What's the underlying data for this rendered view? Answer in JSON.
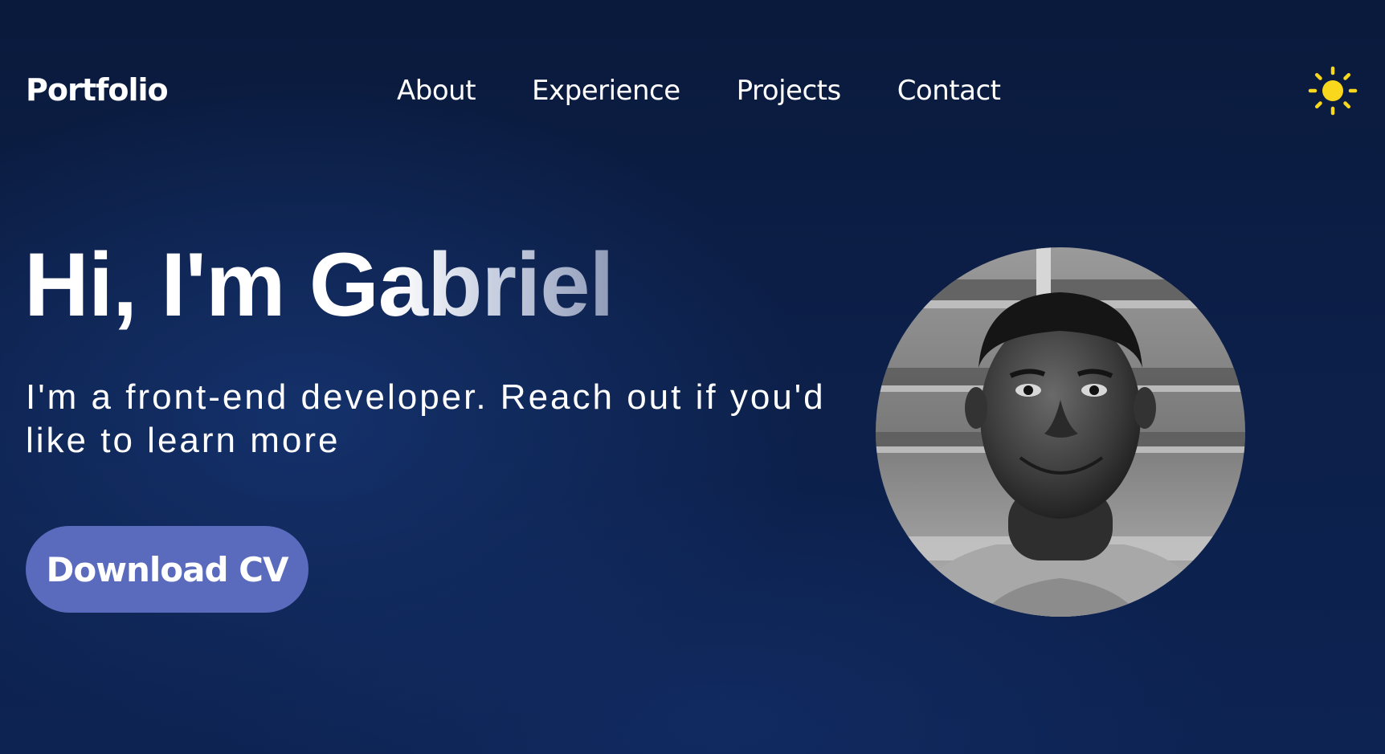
{
  "header": {
    "logo": "Portfolio",
    "nav": [
      {
        "label": "About"
      },
      {
        "label": "Experience"
      },
      {
        "label": "Projects"
      },
      {
        "label": "Contact"
      }
    ],
    "theme_toggle_icon": "sun-icon"
  },
  "hero": {
    "title": "Hi, I'm Gabriel",
    "subtitle": "I'm a front-end developer. Reach out if you'd like to learn more",
    "cta_label": "Download CV",
    "avatar_icon": "profile-photo"
  },
  "colors": {
    "background_top": "#0a1a3c",
    "background_bottom": "#0d2352",
    "button": "#5a6bbd",
    "sun": "#f9d71c",
    "text": "#ffffff"
  }
}
